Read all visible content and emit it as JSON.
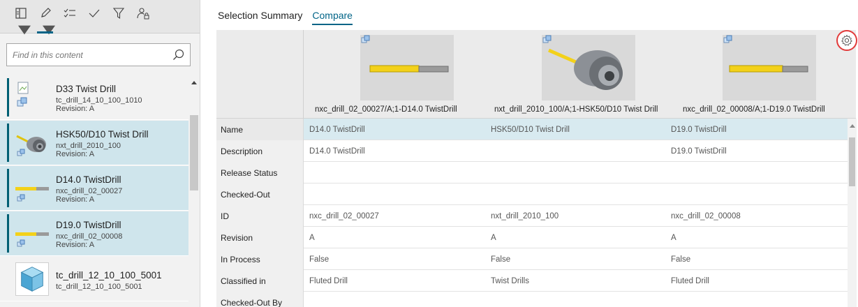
{
  "toolbar": {
    "buttons": [
      {
        "icon": "layout-panel-icon",
        "has_caret": true,
        "active": false
      },
      {
        "icon": "pencil-icon",
        "has_caret": true,
        "active": true
      },
      {
        "icon": "checklist-icon",
        "has_caret": false,
        "active": false
      },
      {
        "icon": "checkmark-icon",
        "has_caret": false,
        "active": false
      },
      {
        "icon": "filter-icon",
        "has_caret": false,
        "active": false
      },
      {
        "icon": "user-lock-icon",
        "has_caret": false,
        "active": false
      }
    ]
  },
  "search": {
    "placeholder": "Find in this content",
    "icon": "search-icon"
  },
  "list": {
    "items": [
      {
        "title": "D33 Twist Drill",
        "subtitle": "tc_drill_14_10_100_1010",
        "revision_label": "Revision:",
        "revision": "A",
        "selected": false,
        "thumb": "broken-image"
      },
      {
        "title": "HSK50/D10 Twist Drill",
        "subtitle": "nxt_drill_2010_100",
        "revision_label": "Revision:",
        "revision": "A",
        "selected": true,
        "thumb": "tool-holder"
      },
      {
        "title": "D14.0 TwistDrill",
        "subtitle": "nxc_drill_02_00027",
        "revision_label": "Revision:",
        "revision": "A",
        "selected": true,
        "thumb": "drill"
      },
      {
        "title": "D19.0 TwistDrill",
        "subtitle": "nxc_drill_02_00008",
        "revision_label": "Revision:",
        "revision": "A",
        "selected": true,
        "thumb": "drill"
      },
      {
        "title": "tc_drill_12_10_100_5001",
        "subtitle": "tc_drill_12_10_100_5001",
        "revision_label": "",
        "revision": "",
        "selected": false,
        "thumb": "cube"
      }
    ]
  },
  "tabs": [
    {
      "label": "Selection Summary",
      "active": false
    },
    {
      "label": "Compare",
      "active": true
    }
  ],
  "compare": {
    "columns": [
      {
        "label": "nxc_drill_02_00027/A;1-D14.0 TwistDrill",
        "image": "drill"
      },
      {
        "label": "nxt_drill_2010_100/A;1-HSK50/D10 Twist Drill",
        "image": "tool-holder"
      },
      {
        "label": "nxc_drill_02_00008/A;1-D19.0 TwistDrill",
        "image": "drill"
      }
    ],
    "rows": [
      {
        "label": "Name",
        "values": [
          "D14.0 TwistDrill",
          "HSK50/D10 Twist Drill",
          "D19.0 TwistDrill"
        ],
        "selected": true
      },
      {
        "label": "Description",
        "values": [
          "D14.0 TwistDrill",
          "",
          "D19.0 TwistDrill"
        ],
        "selected": false
      },
      {
        "label": "Release Status",
        "values": [
          "",
          "",
          ""
        ],
        "selected": false
      },
      {
        "label": "Checked-Out",
        "values": [
          "",
          "",
          ""
        ],
        "selected": false
      },
      {
        "label": "ID",
        "values": [
          "nxc_drill_02_00027",
          "nxt_drill_2010_100",
          "nxc_drill_02_00008"
        ],
        "selected": false
      },
      {
        "label": "Revision",
        "values": [
          "A",
          "A",
          "A"
        ],
        "selected": false
      },
      {
        "label": "In Process",
        "values": [
          "False",
          "False",
          "False"
        ],
        "selected": false
      },
      {
        "label": "Classified in",
        "values": [
          "Fluted Drill",
          "Twist Drills",
          "Fluted Drill"
        ],
        "selected": false
      },
      {
        "label": "Checked-Out By",
        "values": [
          "",
          "",
          ""
        ],
        "selected": false
      }
    ],
    "settings_icon": "gear-icon"
  },
  "colors": {
    "accent": "#006487",
    "selected_item": "#cfe5ec",
    "selected_row": "#d8eaf0",
    "highlight_ring": "#e23a3a",
    "drill_yellow": "#f3d11a"
  }
}
